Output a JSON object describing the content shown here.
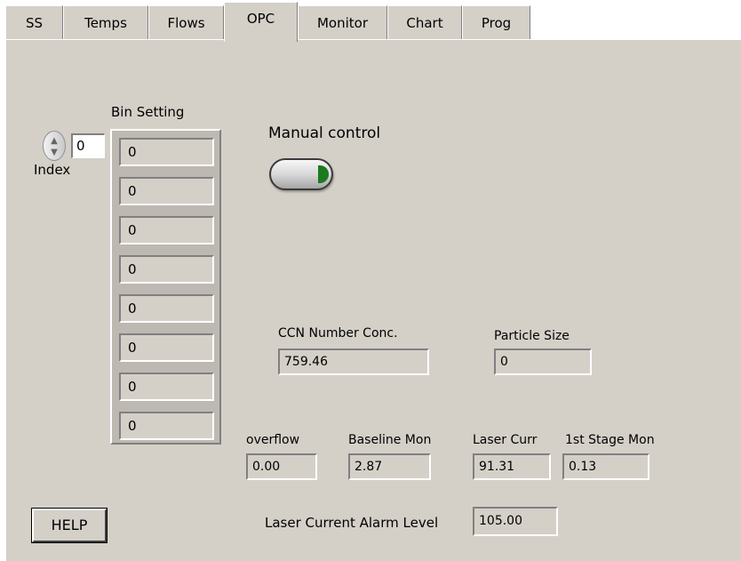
{
  "tabs": [
    {
      "label": "SS"
    },
    {
      "label": "Temps"
    },
    {
      "label": "Flows"
    },
    {
      "label": "OPC"
    },
    {
      "label": "Monitor"
    },
    {
      "label": "Chart"
    },
    {
      "label": "Prog"
    }
  ],
  "active_tab": "OPC",
  "index": {
    "label": "Index",
    "value": "0"
  },
  "bin_setting": {
    "label": "Bin Setting",
    "values": [
      "0",
      "0",
      "0",
      "0",
      "0",
      "0",
      "0",
      "0"
    ]
  },
  "manual_control": {
    "label": "Manual control",
    "state": "on"
  },
  "ccn_number_conc": {
    "label": "CCN Number Conc.",
    "value": "759.46"
  },
  "particle_size": {
    "label": "Particle Size",
    "value": "0"
  },
  "overflow": {
    "label": "overflow",
    "value": "0.00"
  },
  "baseline_mon": {
    "label": "Baseline Mon",
    "value": "2.87"
  },
  "laser_curr": {
    "label": "Laser Curr",
    "value": "91.31"
  },
  "first_stage_mon": {
    "label": "1st Stage Mon",
    "value": "0.13"
  },
  "laser_alarm": {
    "label": "Laser Current Alarm Level",
    "value": "105.00"
  },
  "help_button": {
    "label": "HELP"
  },
  "colors": {
    "panel_bg": "#d4d0c8",
    "led_on": "#1e7a1e"
  }
}
